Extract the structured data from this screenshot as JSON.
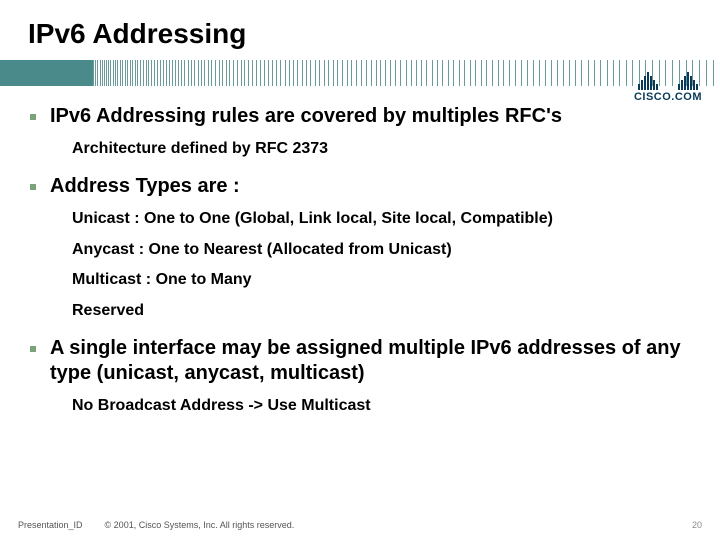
{
  "title": "IPv6 Addressing",
  "logo_text": "CISCO.COM",
  "bullets": [
    {
      "text": "IPv6 Addressing rules are covered by multiples RFC's",
      "subs": [
        "Architecture defined by RFC 2373"
      ]
    },
    {
      "text": "Address Types are :",
      "subs": [
        "Unicast : One to One (Global, Link local, Site local, Compatible)",
        "Anycast : One to Nearest (Allocated from Unicast)",
        "Multicast : One to Many",
        "Reserved"
      ]
    },
    {
      "text": "A single interface may be assigned multiple IPv6 addresses of any type (unicast, anycast, multicast)",
      "subs": [
        "No Broadcast Address -> Use Multicast"
      ]
    }
  ],
  "footer": {
    "presentation_id": "Presentation_ID",
    "copyright": "© 2001, Cisco Systems, Inc. All rights reserved.",
    "page_number": "20"
  }
}
